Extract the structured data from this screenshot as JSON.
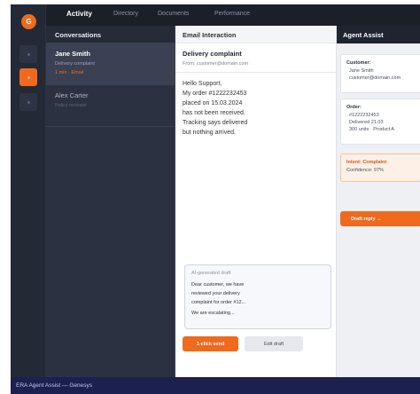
{
  "brand": {
    "logo_letter": "G",
    "accent": "#ef6a1d"
  },
  "rail": {
    "items": [
      {
        "icon": "dot-icon",
        "active": false
      },
      {
        "icon": "dot-icon",
        "active": true
      },
      {
        "icon": "dot-icon",
        "active": false
      }
    ]
  },
  "topnav": {
    "tabs": [
      "Activity",
      "Directory",
      "Documents",
      "Performance"
    ],
    "active": "Activity"
  },
  "conversations": {
    "title": "Conversations",
    "items": [
      {
        "name": "Jane Smith",
        "subtitle": "Delivery complaint",
        "meta": "1 min · Email",
        "selected": true
      },
      {
        "name": "Alex Carter",
        "subtitle": "Policy renewal",
        "meta": "",
        "selected": false
      }
    ]
  },
  "email": {
    "header": "Email Interaction",
    "subject": "Delivery complaint",
    "from": "From: customer@domain.com",
    "body": [
      "Hello Support,",
      "My order #1222232453",
      "placed on 15.03.2024",
      "has not been received.",
      "Tracking says delivered",
      "but nothing arrived."
    ],
    "draft": {
      "label": "AI-generated draft",
      "lines": [
        "Dear customer, we have",
        "reviewed your delivery",
        "complaint for order #12..."
      ],
      "last_line": "We are escalating..."
    },
    "send_label": "1-click send",
    "edit_label": "Edit draft"
  },
  "assist": {
    "header": "Agent Assist",
    "customer": {
      "title": "Customer:",
      "lines": [
        "Jane Smith",
        "customer@domain.com"
      ]
    },
    "order": {
      "title": "Order:",
      "lines": [
        "#1222232453",
        "Delivered 21.03",
        "300 units · Product A"
      ]
    },
    "intent": {
      "title": "Intent: Complaint",
      "confidence": "Confidence: 97%"
    },
    "draft_button": "Draft reply →"
  },
  "footer": {
    "text": "ERA Agent Assist — Genesys"
  }
}
